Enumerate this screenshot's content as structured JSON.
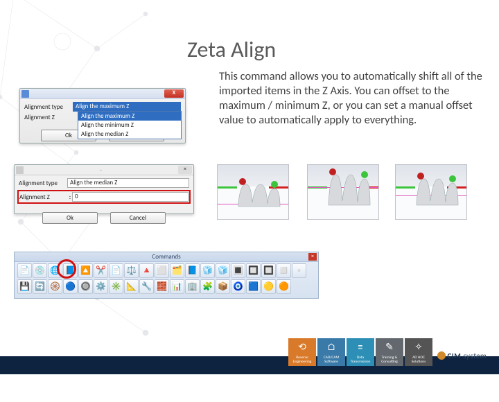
{
  "title": "Zeta Align",
  "description": "This command allows you to automatically shift all of the imported items in the Z Axis. You can offset to the maximum / minimum Z, or you can set a manual offset value to automatically apply to everything.",
  "dialog1": {
    "label_type": "Alignment type",
    "label_z": "Alignment Z",
    "selected": "Align the maximum Z",
    "options": [
      "Align the maximum Z",
      "Align the minimum Z",
      "Align the median Z"
    ],
    "ok": "Ok",
    "cancel": "Cancel"
  },
  "dialog2": {
    "label_type": "Alignment type",
    "type_value": "Align the median Z",
    "label_z": "Alignment Z",
    "z_value": "0",
    "ok": "Ok",
    "cancel": "Cancel",
    "dash": "-"
  },
  "commands": {
    "title": "Commands",
    "row1": [
      "📄",
      "💿",
      "🌐",
      "📘",
      "🔼",
      "✂️",
      "📄",
      "⚖️",
      "🔺",
      "⬜",
      "🗂️",
      "📘",
      "🧊",
      "🧊",
      "🔳",
      "🔲",
      "🔲",
      "◻️",
      "▫️"
    ],
    "row2": [
      "💾",
      "🔄",
      "🛞",
      "🔵",
      "🔘",
      "⚙️",
      "✳️",
      "📐",
      "🔧",
      "🧱",
      "📊",
      "🏢",
      "🧩",
      "📦",
      "🧿",
      "🟦",
      "🟡",
      "🟠"
    ]
  },
  "footer": {
    "tiles": [
      {
        "line1": "Reverse",
        "line2": "Engineering"
      },
      {
        "line1": "CAD/CAM",
        "line2": "Software"
      },
      {
        "line1": "Data",
        "line2": "Transmission"
      },
      {
        "line1": "Training &",
        "line2": "Consulting"
      },
      {
        "line1": "AD HOC",
        "line2": "Solutions"
      }
    ],
    "brand1": "CIM",
    "brand2": "system"
  }
}
